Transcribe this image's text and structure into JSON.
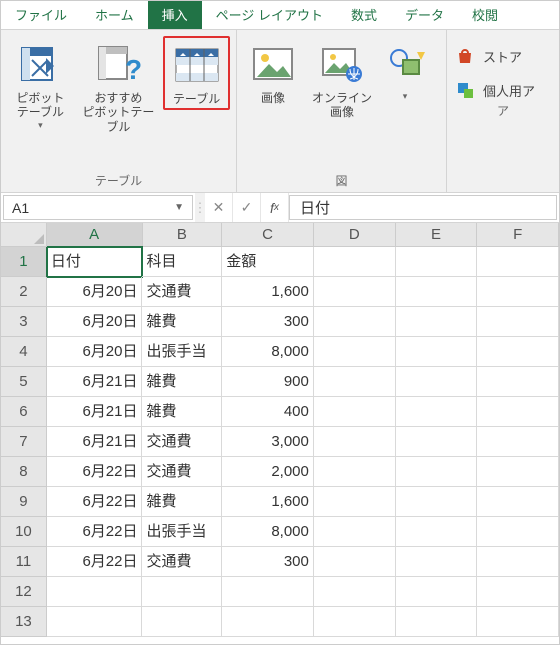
{
  "tabs": {
    "file": "ファイル",
    "home": "ホーム",
    "insert": "挿入",
    "pagelayout": "ページ レイアウト",
    "formulas": "数式",
    "data": "データ",
    "review": "校閲"
  },
  "ribbon": {
    "groups": {
      "tables_label": "テーブル",
      "illustrations_label": "図",
      "addins_label": "ア"
    },
    "buttons": {
      "pivot": "ピボット\nテーブル",
      "recommended_pivot": "おすすめ\nピボットテーブル",
      "table": "テーブル",
      "pictures": "画像",
      "online_pictures": "オンライン\n画像"
    },
    "side": {
      "store": "ストア",
      "personal": "個人用ア"
    }
  },
  "namebox": "A1",
  "formula": "日付",
  "columns": [
    "A",
    "B",
    "C",
    "D",
    "E",
    "F"
  ],
  "sheet": {
    "headers": {
      "a": "日付",
      "b": "科目",
      "c": "金額"
    },
    "rows": [
      {
        "a": "6月20日",
        "b": "交通費",
        "c": "1,600"
      },
      {
        "a": "6月20日",
        "b": "雑費",
        "c": "300"
      },
      {
        "a": "6月20日",
        "b": "出張手当",
        "c": "8,000"
      },
      {
        "a": "6月21日",
        "b": "雑費",
        "c": "900"
      },
      {
        "a": "6月21日",
        "b": "雑費",
        "c": "400"
      },
      {
        "a": "6月21日",
        "b": "交通費",
        "c": "3,000"
      },
      {
        "a": "6月22日",
        "b": "交通費",
        "c": "2,000"
      },
      {
        "a": "6月22日",
        "b": "雑費",
        "c": "1,600"
      },
      {
        "a": "6月22日",
        "b": "出張手当",
        "c": "8,000"
      },
      {
        "a": "6月22日",
        "b": "交通費",
        "c": "300"
      }
    ]
  },
  "chart_data": {
    "type": "table",
    "columns": [
      "日付",
      "科目",
      "金額"
    ],
    "rows": [
      [
        "6月20日",
        "交通費",
        1600
      ],
      [
        "6月20日",
        "雑費",
        300
      ],
      [
        "6月20日",
        "出張手当",
        8000
      ],
      [
        "6月21日",
        "雑費",
        900
      ],
      [
        "6月21日",
        "雑費",
        400
      ],
      [
        "6月21日",
        "交通費",
        3000
      ],
      [
        "6月22日",
        "交通費",
        2000
      ],
      [
        "6月22日",
        "雑費",
        1600
      ],
      [
        "6月22日",
        "出張手当",
        8000
      ],
      [
        "6月22日",
        "交通費",
        300
      ]
    ]
  }
}
